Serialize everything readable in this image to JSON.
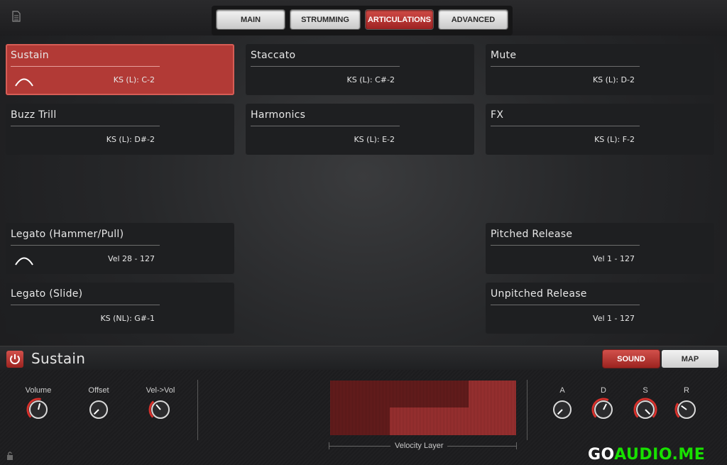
{
  "tabs": [
    {
      "label": "MAIN",
      "active": false
    },
    {
      "label": "STRUMMING",
      "active": false
    },
    {
      "label": "ARTICULATIONS",
      "active": true
    },
    {
      "label": "ADVANCED",
      "active": false
    }
  ],
  "articulations": [
    {
      "name": "Sustain",
      "key": "KS (L): C-2",
      "active": true,
      "icon": "arc-icon"
    },
    {
      "name": "Staccato",
      "key": "KS (L): C#-2",
      "active": false
    },
    {
      "name": "Mute",
      "key": "KS (L): D-2",
      "active": false
    },
    {
      "name": "Buzz Trill",
      "key": "KS (L): D#-2",
      "active": false
    },
    {
      "name": "Harmonics",
      "key": "KS (L): E-2",
      "active": false
    },
    {
      "name": "FX",
      "key": "KS (L): F-2",
      "active": false
    },
    {
      "name": "Legato (Hammer/Pull)",
      "key": "Vel 28 - 127",
      "active": false,
      "icon": "arc-icon"
    },
    {
      "name": "Pitched Release",
      "key": "Vel 1 - 127",
      "active": false
    },
    {
      "name": "Legato (Slide)",
      "key": "KS (NL): G#-1",
      "active": false
    },
    {
      "name": "Unpitched Release",
      "key": "Vel 1 - 127",
      "active": false
    }
  ],
  "selected": {
    "title": "Sustain",
    "power_icon": "power-icon",
    "sound_label": "SOUND",
    "map_label": "MAP"
  },
  "knobs_left": [
    {
      "label": "Volume",
      "value": 0.55
    },
    {
      "label": "Offset",
      "value": 0.0
    },
    {
      "label": "Vel->Vol",
      "value": 0.35
    }
  ],
  "envelope": [
    {
      "label": "A",
      "value": 0.0
    },
    {
      "label": "D",
      "value": 0.6
    },
    {
      "label": "S",
      "value": 1.0
    },
    {
      "label": "R",
      "value": 0.3
    }
  ],
  "velocity_layer": {
    "label": "Velocity Layer",
    "layer_a_range": [
      0,
      127
    ],
    "layer_b_range": [
      28,
      127
    ]
  },
  "watermark": {
    "prefix": "GO",
    "accent": "AUDIO.ME"
  },
  "colors": {
    "accent": "#b23a36",
    "watermark_green": "#18e000"
  }
}
